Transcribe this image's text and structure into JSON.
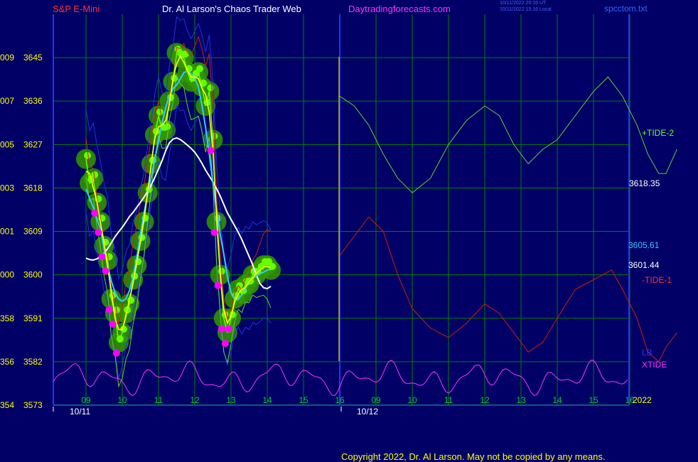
{
  "header": {
    "symbol": "S&P E-Mini",
    "title": "Dr. Al Larson's Chaos Trader Web",
    "site": "Daytradingforecasts.com",
    "timestamp_utc": "10/11/2022 20:16 UT",
    "timestamp_local": "10/11/2022 15:16 Local",
    "file": "spcctom.txt"
  },
  "copyright": "Copyright 2022, Dr. Al Larson. May not be copied by any means.",
  "colors": {
    "background": "#000066",
    "grid": "#008000",
    "price": "#66ff00",
    "price_band": "#339900",
    "ma_fast": "#ffff00",
    "ma_mid": "#33ccff",
    "ma_slow": "#ffffff",
    "tide_plus": "#66cc33",
    "tide_minus": "#cc2200",
    "lb": "#2233dd",
    "xtide": "#ff33ff",
    "dots": "#ff00ff",
    "now_line": "#ffff00"
  },
  "chart_data": {
    "type": "line",
    "title": "S&P E-Mini",
    "ylabels": [
      {
        "code": "009",
        "price": "3645"
      },
      {
        "code": "007",
        "price": "3636"
      },
      {
        "code": "005",
        "price": "3627"
      },
      {
        "code": "003",
        "price": "3618"
      },
      {
        "code": "001",
        "price": "3609"
      },
      {
        "code": "000",
        "price": "3600"
      },
      {
        "code": "358",
        "price": "3591"
      },
      {
        "code": "356",
        "price": "3582"
      },
      {
        "code": "354",
        "price": "3573"
      }
    ],
    "ylim": [
      3573,
      3654
    ],
    "x_hour_labels": [
      "09",
      "10",
      "11",
      "12",
      "13",
      "14",
      "15",
      "16",
      "09",
      "10",
      "11",
      "12",
      "13",
      "14",
      "15",
      "16"
    ],
    "x_dates": [
      "10/11",
      "10/12"
    ],
    "year_label": "2022",
    "now_hour_index": 7,
    "price_series": [
      [
        0,
        3624
      ],
      [
        0.1,
        3619
      ],
      [
        0.2,
        3620
      ],
      [
        0.3,
        3615
      ],
      [
        0.4,
        3611
      ],
      [
        0.5,
        3606
      ],
      [
        0.6,
        3603
      ],
      [
        0.7,
        3595
      ],
      [
        0.8,
        3592
      ],
      [
        0.9,
        3586
      ],
      [
        1.0,
        3588
      ],
      [
        1.1,
        3592
      ],
      [
        1.2,
        3594
      ],
      [
        1.3,
        3599
      ],
      [
        1.4,
        3602
      ],
      [
        1.5,
        3607
      ],
      [
        1.6,
        3611
      ],
      [
        1.7,
        3617
      ],
      [
        1.8,
        3623
      ],
      [
        1.9,
        3629
      ],
      [
        2.0,
        3633
      ],
      [
        2.1,
        3630
      ],
      [
        2.2,
        3630
      ],
      [
        2.3,
        3636
      ],
      [
        2.4,
        3640
      ],
      [
        2.5,
        3646
      ],
      [
        2.6,
        3645
      ],
      [
        2.7,
        3645
      ],
      [
        2.8,
        3642
      ],
      [
        2.9,
        3640
      ],
      [
        3.0,
        3641
      ],
      [
        3.1,
        3642
      ],
      [
        3.2,
        3639
      ],
      [
        3.3,
        3635
      ],
      [
        3.4,
        3638
      ],
      [
        3.5,
        3628
      ],
      [
        3.6,
        3611
      ],
      [
        3.7,
        3600
      ],
      [
        3.8,
        3591
      ],
      [
        3.9,
        3588
      ],
      [
        4.0,
        3591
      ],
      [
        4.1,
        3595
      ],
      [
        4.2,
        3597
      ],
      [
        4.3,
        3596
      ],
      [
        4.4,
        3598
      ],
      [
        4.5,
        3598
      ],
      [
        4.6,
        3600
      ],
      [
        4.7,
        3600
      ],
      [
        4.8,
        3601
      ],
      [
        4.9,
        3602
      ],
      [
        5.0,
        3602
      ],
      [
        5.1,
        3601
      ]
    ],
    "series": [
      {
        "name": "+TIDE-2",
        "end_label": "+TIDE-2",
        "points": [
          [
            7,
            3637
          ],
          [
            7.4,
            3635
          ],
          [
            7.8,
            3631
          ],
          [
            8.2,
            3625
          ],
          [
            8.6,
            3620
          ],
          [
            9,
            3617
          ],
          [
            9.5,
            3620
          ],
          [
            10,
            3627
          ],
          [
            10.5,
            3632
          ],
          [
            11,
            3635
          ],
          [
            11.4,
            3633
          ],
          [
            11.8,
            3627
          ],
          [
            12.2,
            3623
          ],
          [
            12.6,
            3626
          ],
          [
            13,
            3628
          ],
          [
            13.5,
            3633
          ],
          [
            14,
            3638
          ],
          [
            14.4,
            3641
          ],
          [
            14.8,
            3637
          ],
          [
            15.2,
            3631
          ],
          [
            15.5,
            3625
          ],
          [
            15.8,
            3621
          ],
          [
            16,
            3621
          ],
          [
            16.3,
            3626
          ]
        ]
      },
      {
        "name": "-TIDE-1",
        "end_label": "-TIDE-1",
        "points": [
          [
            7,
            3604
          ],
          [
            7.4,
            3608
          ],
          [
            7.8,
            3612
          ],
          [
            8.2,
            3609
          ],
          [
            8.6,
            3600
          ],
          [
            9,
            3593
          ],
          [
            9.5,
            3589
          ],
          [
            10,
            3587
          ],
          [
            10.5,
            3590
          ],
          [
            11,
            3594
          ],
          [
            11.4,
            3592
          ],
          [
            11.8,
            3588
          ],
          [
            12.2,
            3584
          ],
          [
            12.6,
            3586
          ],
          [
            13,
            3591
          ],
          [
            13.5,
            3597
          ],
          [
            14,
            3599
          ],
          [
            14.5,
            3601
          ],
          [
            14.8,
            3597
          ],
          [
            15.2,
            3591
          ],
          [
            15.5,
            3584
          ],
          [
            15.8,
            3582
          ],
          [
            16,
            3585
          ],
          [
            16.3,
            3588
          ]
        ]
      },
      {
        "name": "MA-fast",
        "value": "3601.44"
      },
      {
        "name": "MA-mid",
        "value": "3605.61"
      },
      {
        "name": "MA-slow",
        "value": "3618.35"
      },
      {
        "name": "LB",
        "end_label": "LB"
      },
      {
        "name": "XTIDE",
        "end_label": "XTIDE"
      }
    ],
    "right_value_labels": [
      "3618.35",
      "3605.61",
      "3601.44"
    ],
    "grid": true
  }
}
